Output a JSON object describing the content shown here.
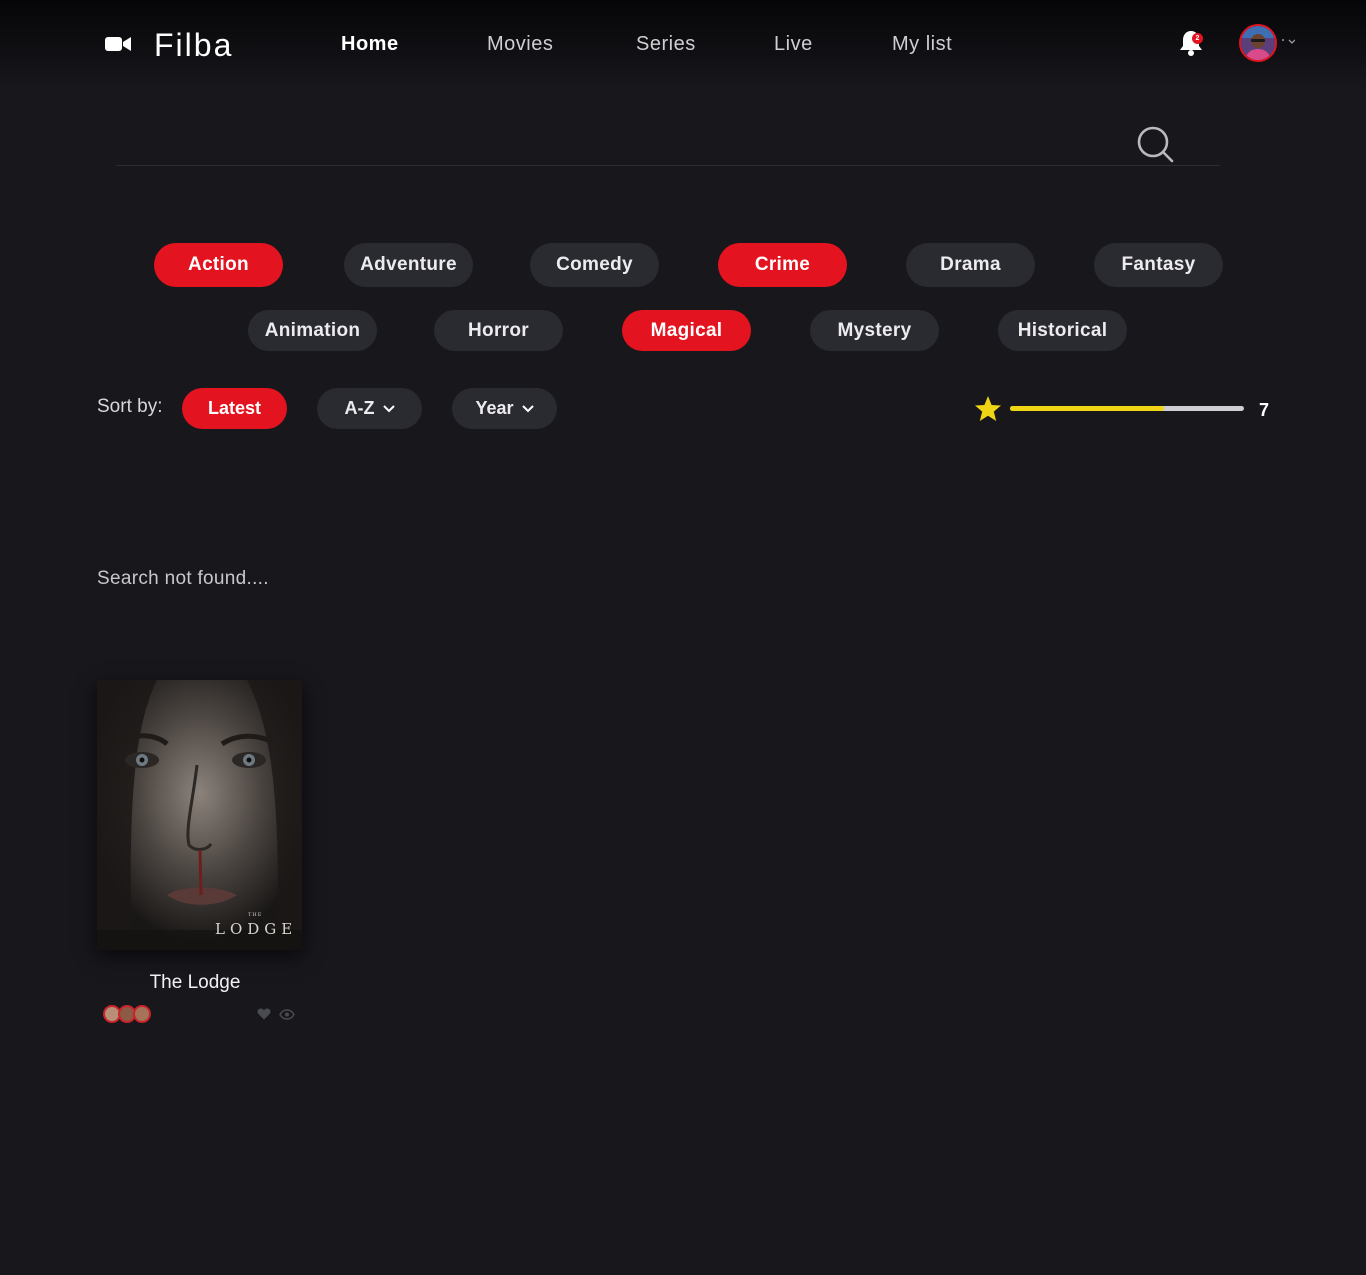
{
  "app": {
    "name": "Filba",
    "logo_icon": "video-camera-icon"
  },
  "nav": {
    "items": [
      {
        "label": "Home",
        "active": true
      },
      {
        "label": "Movies",
        "active": false
      },
      {
        "label": "Series",
        "active": false
      },
      {
        "label": "Live",
        "active": false
      },
      {
        "label": "My list",
        "active": false
      }
    ]
  },
  "notifications": {
    "count": "2",
    "icon": "bell-icon"
  },
  "profile": {
    "icon": "avatar"
  },
  "search": {
    "value": "",
    "placeholder": "",
    "icon": "search-icon"
  },
  "genres": [
    {
      "label": "Action",
      "active": true
    },
    {
      "label": "Adventure",
      "active": false
    },
    {
      "label": "Comedy",
      "active": false
    },
    {
      "label": "Crime",
      "active": true
    },
    {
      "label": "Drama",
      "active": false
    },
    {
      "label": "Fantasy",
      "active": false
    },
    {
      "label": "Animation",
      "active": false
    },
    {
      "label": "Horror",
      "active": false
    },
    {
      "label": "Magical",
      "active": true
    },
    {
      "label": "Mystery",
      "active": false
    },
    {
      "label": "Historical",
      "active": false
    }
  ],
  "sort": {
    "label": "Sort by:",
    "options": [
      {
        "label": "Latest",
        "active": true
      },
      {
        "label": "A-Z",
        "active": false
      },
      {
        "label": "Year",
        "active": false
      }
    ]
  },
  "rating": {
    "value": "7",
    "fill_fraction": 0.66
  },
  "status": {
    "text": "Search not found...."
  },
  "movies": [
    {
      "title": "The Lodge",
      "poster_title": "LODGE",
      "poster_the": "THE"
    }
  ],
  "colors": {
    "background": "#17171c",
    "accent": "#e3141f",
    "pill": "#2a2a31",
    "rating": "#f0d514"
  }
}
